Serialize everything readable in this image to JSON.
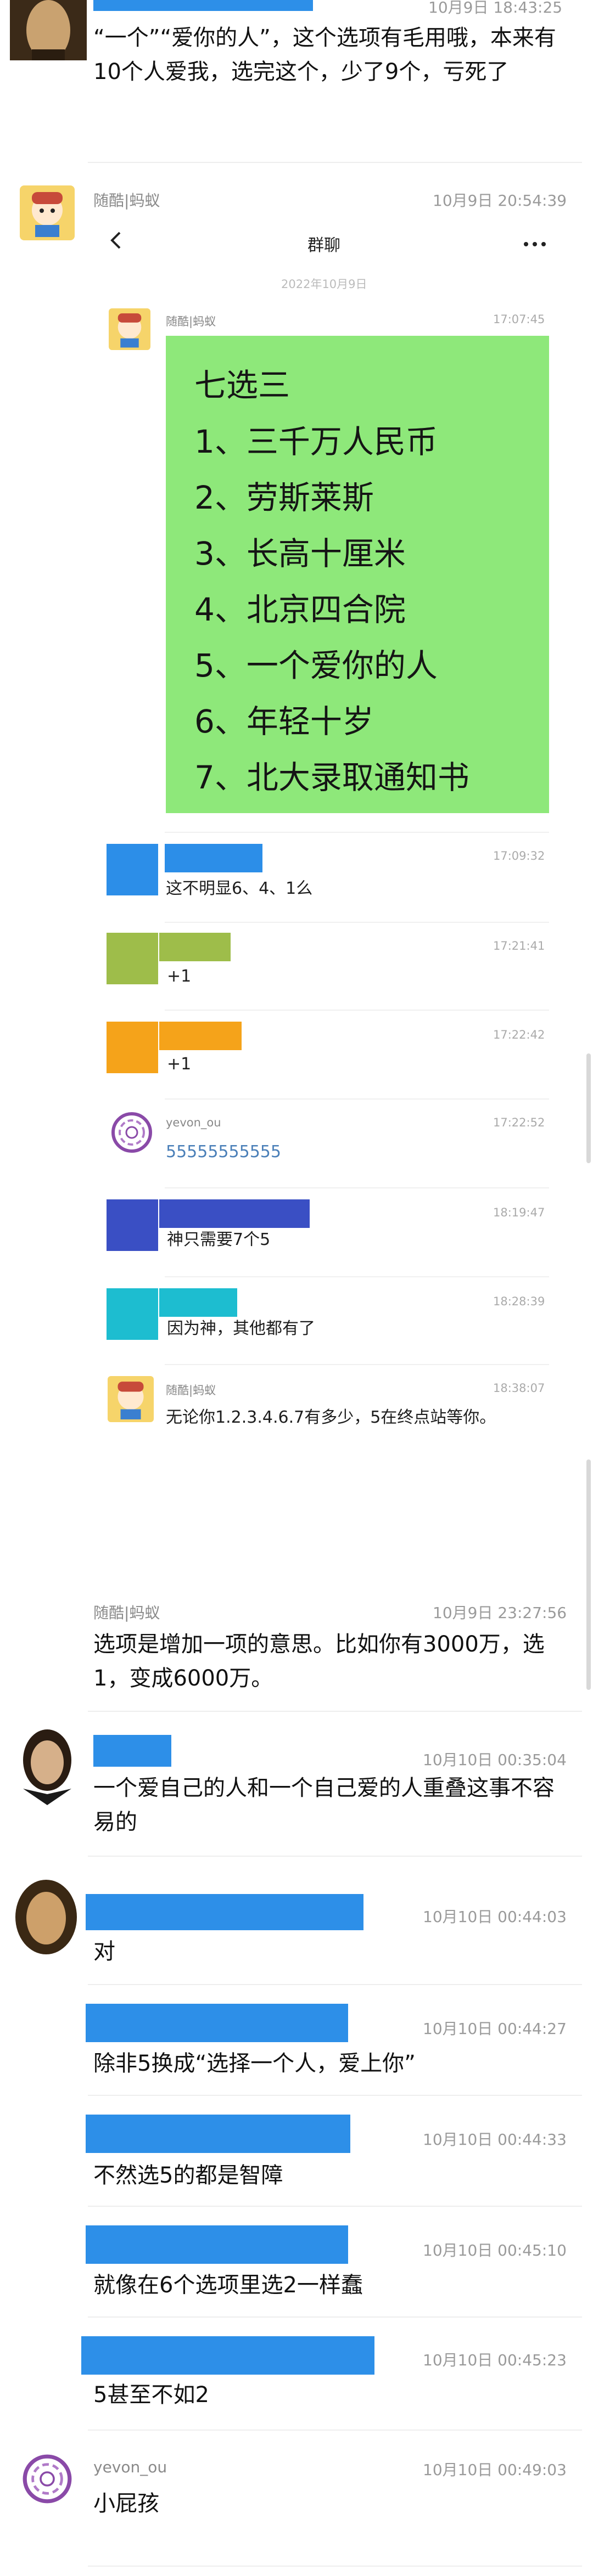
{
  "messages": {
    "m1": {
      "ts": "10月9日 18:43:25",
      "text": "“一个”“爱你的人”，这个选项有毛用哦，本来有10个人爱我，选完这个，少了9个，亏死了"
    },
    "m2": {
      "name": "随酷|蚂蚁",
      "ts": "10月9日 20:54:39"
    },
    "m3": {
      "name": "随酷|蚂蚁",
      "ts": "10月9日 23:27:56",
      "text": "选项是增加一项的意思。比如你有3000万，选1，变成6000万。"
    },
    "m4": {
      "ts": "10月10日 00:35:04",
      "text": "一个爱自己的人和一个自己爱的人重叠这事不容易的"
    },
    "m5": {
      "ts": "10月10日 00:44:03",
      "text": "对"
    },
    "m6": {
      "ts": "10月10日 00:44:27",
      "text": "除非5换成“选择一个人，爱上你”"
    },
    "m7": {
      "ts": "10月10日 00:44:33",
      "text": "不然选5的都是智障"
    },
    "m8": {
      "ts": "10月10日 00:45:10",
      "text": "就像在6个选项里选2一样蠢"
    },
    "m9": {
      "ts": "10月10日 00:45:23",
      "text": "5甚至不如2"
    },
    "m10": {
      "name": "yevon_ou",
      "ts": "10月10日 00:49:03",
      "text": "小屁孩"
    }
  },
  "inner": {
    "header_title": "群聊",
    "back_icon": "chevron-left-icon",
    "more_icon": "more-dots-icon",
    "date": "2022年10月9日",
    "poster_name": "随酷|蚂蚁",
    "poster_ts": "17:07:45",
    "green_card": [
      "七选三",
      "1、三千万人民币",
      "2、劳斯莱斯",
      "3、长高十厘米",
      "4、北京四合院",
      "5、一个爱你的人",
      "6、年轻十岁",
      "7、北大录取通知书"
    ],
    "replies": [
      {
        "ts": "17:09:32",
        "text": "这不明显6、4、1么",
        "color": "#2c8ee8"
      },
      {
        "ts": "17:21:41",
        "text": "+1",
        "color": "#9ebd4a"
      },
      {
        "ts": "17:22:42",
        "text": "+1",
        "color": "#f5a31a"
      },
      {
        "name": "yevon_ou",
        "ts": "17:22:52",
        "text": "55555555555"
      },
      {
        "ts": "18:19:47",
        "text": "神只需要7个5",
        "color": "#3a4fc4"
      },
      {
        "ts": "18:28:39",
        "text": "因为神，其他都有了",
        "color": "#1dbdd0"
      },
      {
        "name": "随酷|蚂蚁",
        "ts": "18:38:07",
        "text": "无论你1.2.3.4.6.7有多少，5在终点站等你。"
      }
    ]
  },
  "colors": {
    "blue_bar": "#2d8fe8",
    "green_card": "#8ee87a",
    "link_blue": "#4a7fb8"
  }
}
